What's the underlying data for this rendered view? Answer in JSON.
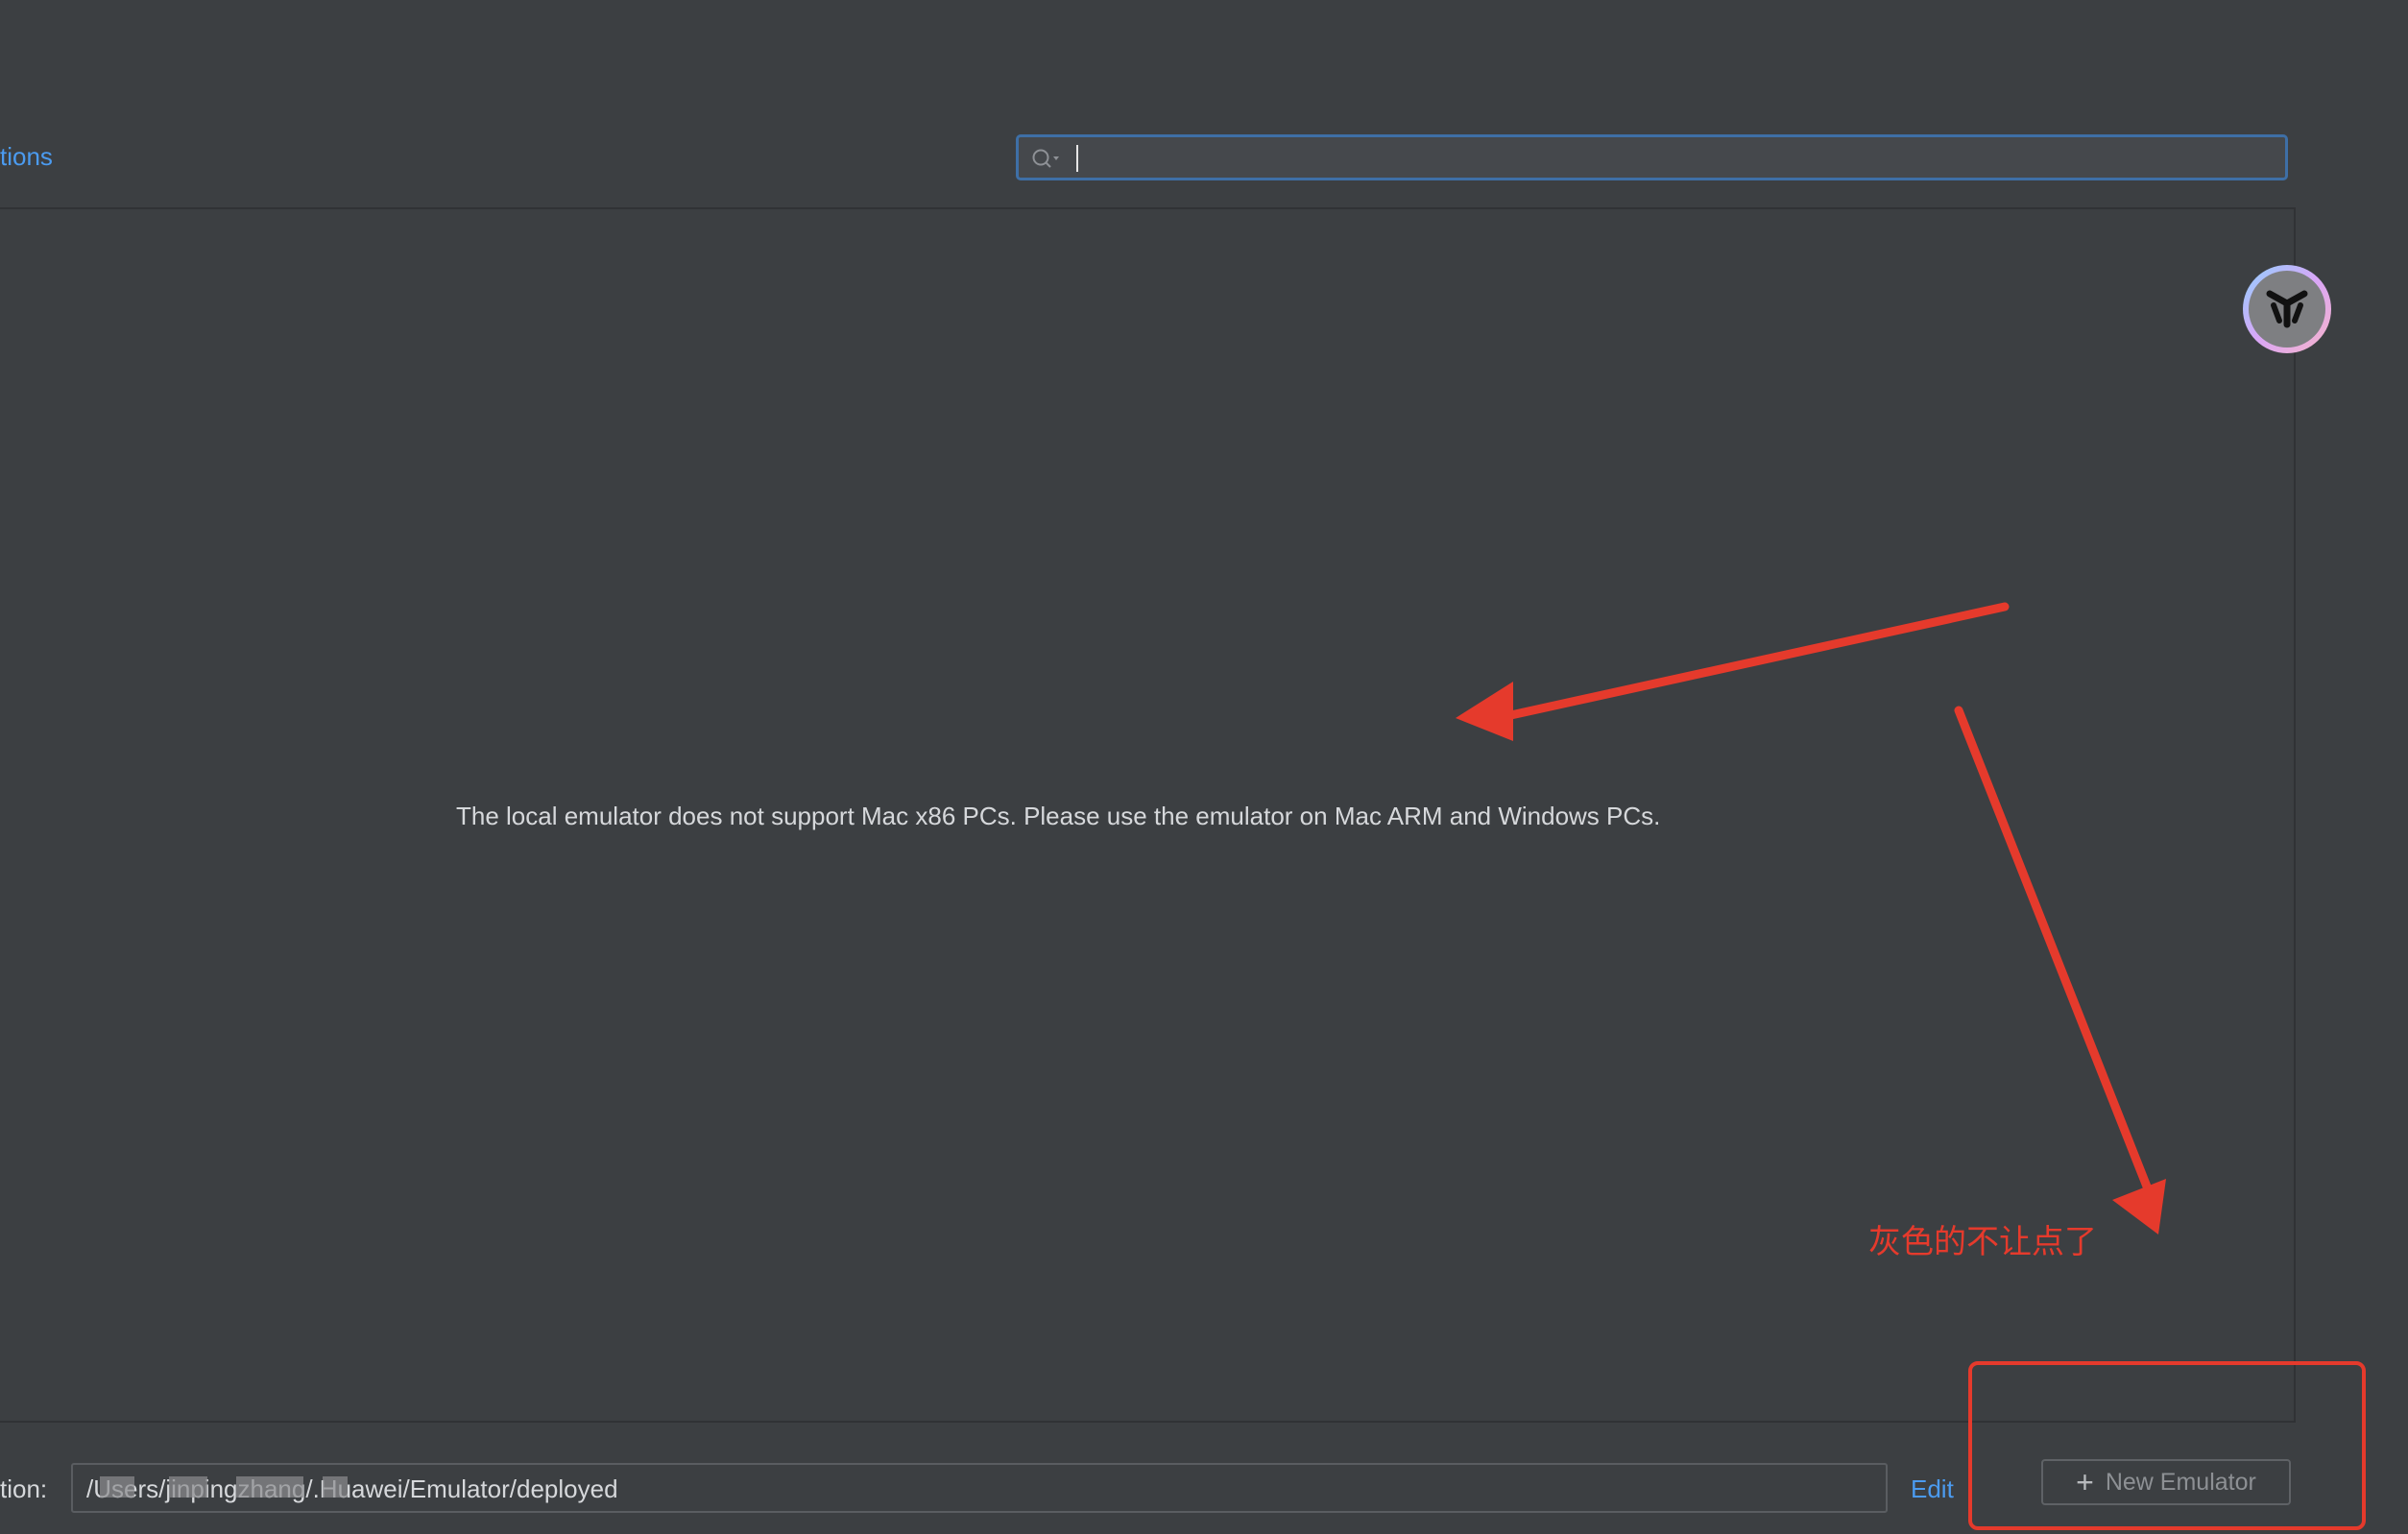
{
  "header": {
    "tab_fragment": "tions"
  },
  "search": {
    "placeholder": "",
    "value": "",
    "icon": "search-icon"
  },
  "main": {
    "empty_message": "The local emulator does not support Mac x86 PCs. Please use the emulator on Mac ARM and Windows PCs."
  },
  "footer": {
    "location_label": "tion:",
    "location_path": "/Users/jinpingzhang/.Huawei/Emulator/deployed",
    "edit_label": "Edit",
    "new_emulator_label": "New Emulator",
    "new_emulator_icon": "plus-icon",
    "new_emulator_disabled": true
  },
  "annotation": {
    "text": "灰色的不让点了",
    "color": "#e53a2c"
  },
  "colors": {
    "background": "#3c3f42",
    "link": "#4b9bf0",
    "search_border": "#3e6fa6",
    "annotation": "#e53a2c"
  }
}
